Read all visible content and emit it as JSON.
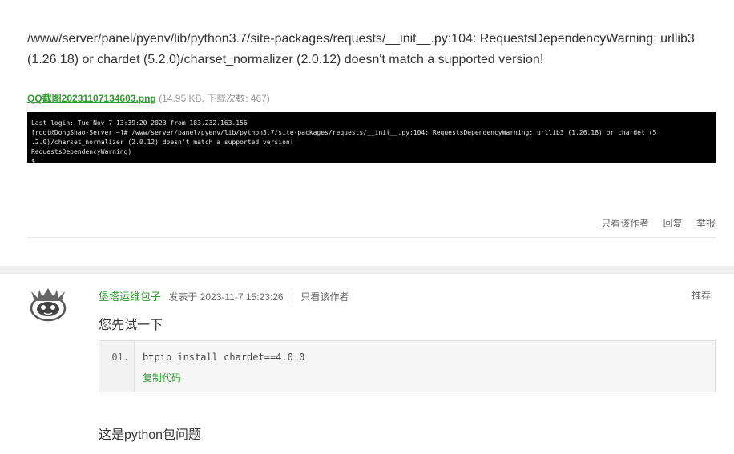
{
  "post": {
    "error_text": "/www/server/panel/pyenv/lib/python3.7/site-packages/requests/__init__.py:104: RequestsDependencyWarning: urllib3 (1.26.18) or chardet (5.2.0)/charset_normalizer (2.0.12) doesn't match a supported version!",
    "attachment": {
      "filename": "QQ截图20231107134603.png",
      "info": " (14.95 KB, 下载次数: 467)"
    },
    "terminal_lines": [
      "Last login: Tue Nov  7 13:39:20 2023 from 183.232.163.156",
      "[root@DongShao-Server ~]# /www/server/panel/pyenv/lib/python3.7/site-packages/requests/__init__.py:104: RequestsDependencyWarning: urllib3 (1.26.18) or chardet (5",
      ".2.0)/charset_normalizer (2.0.12) doesn't match a supported version!",
      "  RequestsDependencyWarning)",
      "$"
    ],
    "actions": {
      "only_author": "只看该作者",
      "reply": "回复",
      "report": "举报"
    }
  },
  "reply": {
    "author": "堡塔运维包子",
    "posted_at": "发表于 2023-11-7 15:23:26",
    "separator": "|",
    "only_author": "只看该作者",
    "recommend": "推荐",
    "text1": "您先试一下",
    "code": {
      "line_number": "01.",
      "content": "btpip install chardet==4.0.0",
      "copy_label": "复制代码"
    },
    "text2": "这是python包问题"
  },
  "colors": {
    "link_green": "#2f9b2f",
    "terminal_bg": "#000000",
    "band_gray": "#eeeeee"
  }
}
